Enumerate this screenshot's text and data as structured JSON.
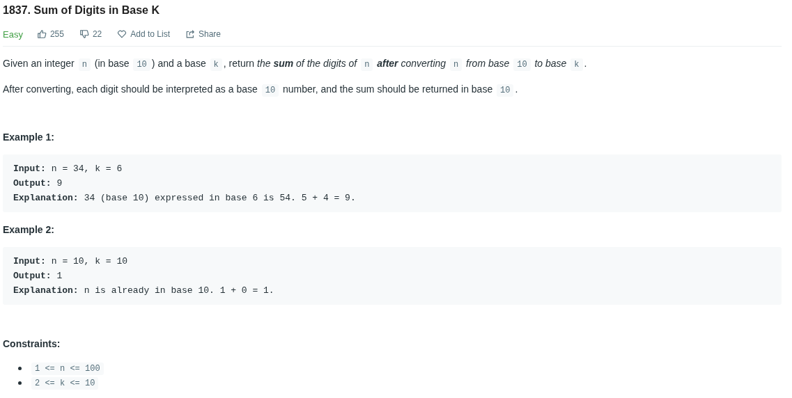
{
  "title": "1837. Sum of Digits in Base K",
  "meta": {
    "difficulty": "Easy",
    "likes": "255",
    "dislikes": "22",
    "add_to_list": "Add to List",
    "share": "Share"
  },
  "description": [
    [
      {
        "kind": "text",
        "text": "Given an integer "
      },
      {
        "kind": "code",
        "text": "n"
      },
      {
        "kind": "text",
        "text": " (in base "
      },
      {
        "kind": "code",
        "text": "10"
      },
      {
        "kind": "text",
        "text": ") and a base "
      },
      {
        "kind": "code",
        "text": "k"
      },
      {
        "kind": "text",
        "text": ", return "
      },
      {
        "kind": "em",
        "text": "the **sum** of the digits of "
      },
      {
        "kind": "code",
        "text": "n"
      },
      {
        "kind": "em",
        "text": " **after** converting "
      },
      {
        "kind": "code",
        "text": "n"
      },
      {
        "kind": "em",
        "text": " from base "
      },
      {
        "kind": "code",
        "text": "10"
      },
      {
        "kind": "em",
        "text": " to base "
      },
      {
        "kind": "code",
        "text": "k"
      },
      {
        "kind": "text",
        "text": "."
      }
    ],
    [
      {
        "kind": "text",
        "text": "After converting, each digit should be interpreted as a base "
      },
      {
        "kind": "code",
        "text": "10"
      },
      {
        "kind": "text",
        "text": " number, and the sum should be returned in base "
      },
      {
        "kind": "code",
        "text": "10"
      },
      {
        "kind": "text",
        "text": "."
      }
    ]
  ],
  "examples": [
    {
      "heading": "Example 1:",
      "lines": [
        {
          "label": "Input:",
          "value": "n = 34, k = 6"
        },
        {
          "label": "Output:",
          "value": "9"
        },
        {
          "label": "Explanation:",
          "value": "34 (base 10) expressed in base 6 is 54. 5 + 4 = 9."
        }
      ]
    },
    {
      "heading": "Example 2:",
      "lines": [
        {
          "label": "Input:",
          "value": "n = 10, k = 10"
        },
        {
          "label": "Output:",
          "value": "1"
        },
        {
          "label": "Explanation:",
          "value": "n is already in base 10. 1 + 0 = 1."
        }
      ]
    }
  ],
  "constraints": {
    "heading": "Constraints:",
    "items": [
      "1 <= n <= 100",
      "2 <= k <= 10"
    ]
  }
}
